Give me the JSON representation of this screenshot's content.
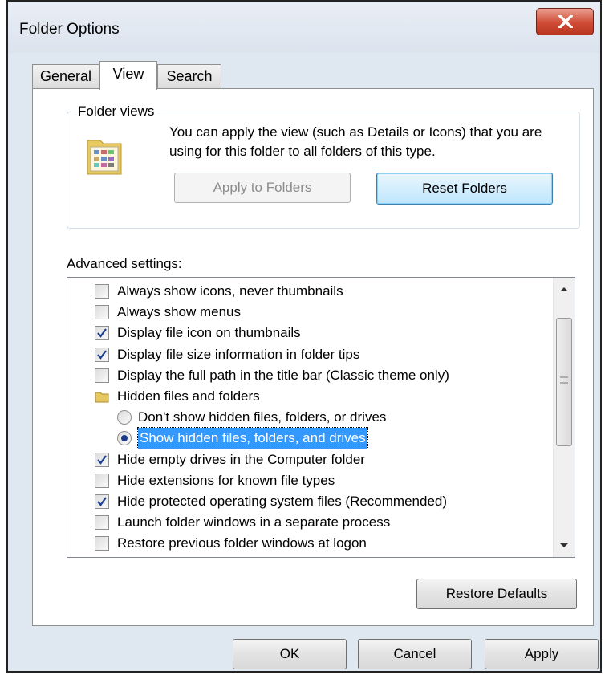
{
  "window": {
    "title": "Folder Options",
    "close_icon": "close-x-icon"
  },
  "tabs": [
    {
      "label": "General",
      "active": false
    },
    {
      "label": "View",
      "active": true
    },
    {
      "label": "Search",
      "active": false
    }
  ],
  "folder_views": {
    "label": "Folder views",
    "description": "You can apply the view (such as Details or Icons) that you are using for this folder to all folders of this type.",
    "apply_button": "Apply to Folders",
    "reset_button": "Reset Folders",
    "icon": "folder-view-icon"
  },
  "advanced": {
    "label": "Advanced settings:",
    "items": [
      {
        "type": "checkbox",
        "label": "Always show icons, never thumbnails",
        "checked": false
      },
      {
        "type": "checkbox",
        "label": "Always show menus",
        "checked": false
      },
      {
        "type": "checkbox",
        "label": "Display file icon on thumbnails",
        "checked": true
      },
      {
        "type": "checkbox",
        "label": "Display file size information in folder tips",
        "checked": true
      },
      {
        "type": "checkbox",
        "label": "Display the full path in the title bar (Classic theme only)",
        "checked": false
      },
      {
        "type": "folder",
        "label": "Hidden files and folders"
      },
      {
        "type": "radio",
        "label": "Don't show hidden files, folders, or drives",
        "checked": false
      },
      {
        "type": "radio",
        "label": "Show hidden files, folders, and drives",
        "checked": true,
        "selected": true
      },
      {
        "type": "checkbox",
        "label": "Hide empty drives in the Computer folder",
        "checked": true
      },
      {
        "type": "checkbox",
        "label": "Hide extensions for known file types",
        "checked": false
      },
      {
        "type": "checkbox",
        "label": "Hide protected operating system files (Recommended)",
        "checked": true
      },
      {
        "type": "checkbox",
        "label": "Launch folder windows in a separate process",
        "checked": false
      },
      {
        "type": "checkbox",
        "label": "Restore previous folder windows at logon",
        "checked": false
      }
    ]
  },
  "restore_defaults": "Restore Defaults",
  "footer": {
    "ok": "OK",
    "cancel": "Cancel",
    "apply": "Apply"
  },
  "colors": {
    "selection": "#3399ff",
    "close_button": "#cf4b36",
    "focus_border": "#3c7fb1"
  }
}
